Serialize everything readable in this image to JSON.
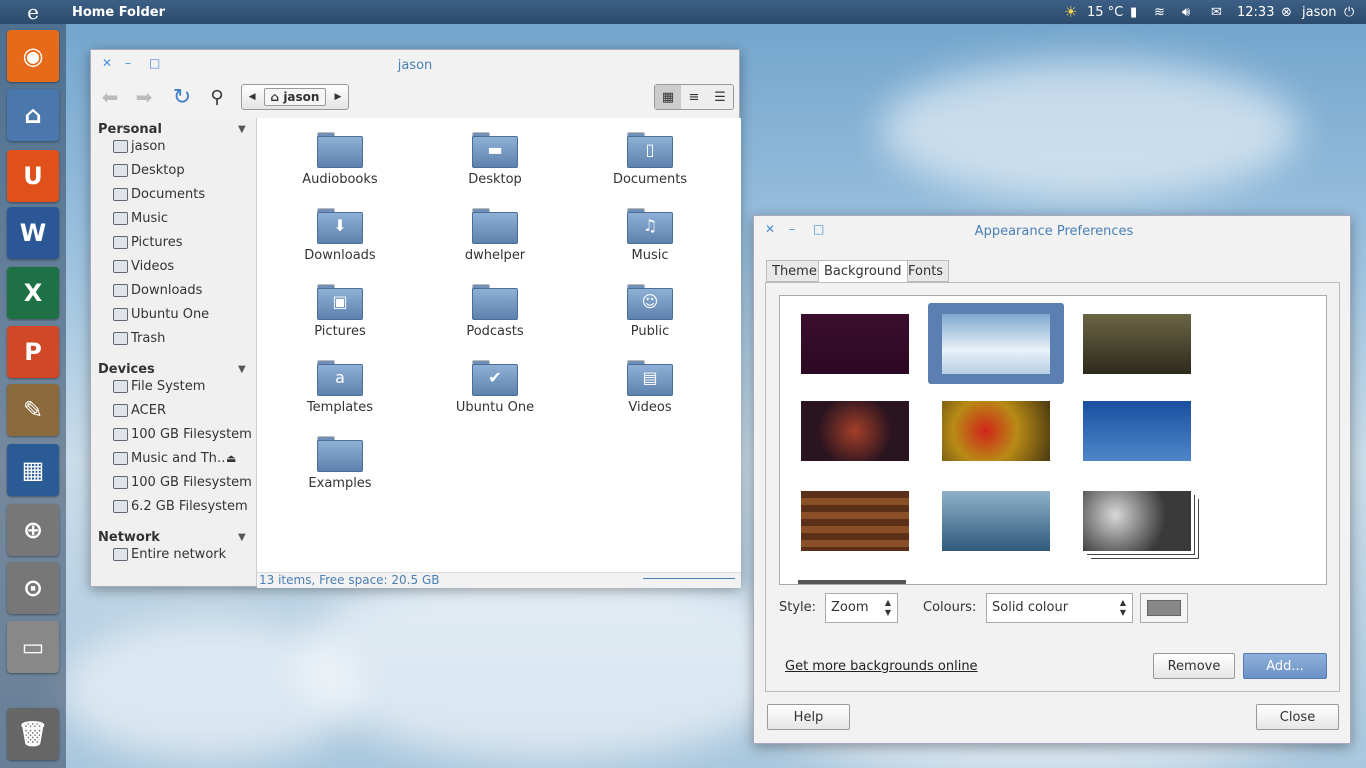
{
  "panel": {
    "logo": "e",
    "title": "Home Folder",
    "temp": "15 °C",
    "time": "12:33",
    "user": "jason"
  },
  "launcher": [
    {
      "name": "firefox-icon",
      "glyph": "◉",
      "color": "#e66a1a"
    },
    {
      "name": "home-folder-icon",
      "glyph": "⌂",
      "color": "#4a78ad"
    },
    {
      "name": "ubuntu-one-icon",
      "glyph": "U",
      "color": "#e0501b"
    },
    {
      "name": "word-icon",
      "glyph": "W",
      "color": "#2b5797"
    },
    {
      "name": "excel-icon",
      "glyph": "X",
      "color": "#1e7145"
    },
    {
      "name": "powerpoint-icon",
      "glyph": "P",
      "color": "#d24726"
    },
    {
      "name": "paint-icon",
      "glyph": "✎",
      "color": "#8b6b3c"
    },
    {
      "name": "workspace-icon",
      "glyph": "▦",
      "color": "#2a5b95"
    },
    {
      "name": "magnifier-icon",
      "glyph": "⊕",
      "color": "#777"
    },
    {
      "name": "search-file-icon",
      "glyph": "⊙",
      "color": "#777"
    },
    {
      "name": "drive-icon",
      "glyph": "▭",
      "color": "#888"
    },
    {
      "name": "trash-icon",
      "glyph": "🗑",
      "color": "#666"
    }
  ],
  "nautilus": {
    "title": "jason",
    "path": "jason",
    "sections": [
      {
        "title": "Personal",
        "items": [
          "jason",
          "Desktop",
          "Documents",
          "Music",
          "Pictures",
          "Videos",
          "Downloads",
          "Ubuntu One",
          "Trash"
        ]
      },
      {
        "title": "Devices",
        "items": [
          "File System",
          "ACER",
          "100 GB Filesystem",
          "Music and Th…",
          "100 GB Filesystem",
          "6.2 GB Filesystem"
        ]
      },
      {
        "title": "Network",
        "items": [
          "Entire network"
        ]
      }
    ],
    "files": [
      {
        "label": "Audiobooks",
        "emblem": ""
      },
      {
        "label": "Desktop",
        "emblem": "▬"
      },
      {
        "label": "Documents",
        "emblem": "▯"
      },
      {
        "label": "Downloads",
        "emblem": "⬇"
      },
      {
        "label": "dwhelper",
        "emblem": ""
      },
      {
        "label": "Music",
        "emblem": "♫"
      },
      {
        "label": "Pictures",
        "emblem": "▣"
      },
      {
        "label": "Podcasts",
        "emblem": ""
      },
      {
        "label": "Public",
        "emblem": "☺"
      },
      {
        "label": "Templates",
        "emblem": "a"
      },
      {
        "label": "Ubuntu One",
        "emblem": "✔"
      },
      {
        "label": "Videos",
        "emblem": "▤"
      },
      {
        "label": "Examples",
        "emblem": ""
      }
    ],
    "status": "13 items, Free space: 20.5 GB"
  },
  "appearance": {
    "title": "Appearance Preferences",
    "tabs": [
      "Theme",
      "Background",
      "Fonts"
    ],
    "style_label": "Style:",
    "style_value": "Zoom",
    "colours_label": "Colours:",
    "colours_value": "Solid colour",
    "more_link": "Get more backgrounds online",
    "remove": "Remove",
    "add": "Add...",
    "help": "Help",
    "close": "Close",
    "wallpapers": [
      {
        "name": "wallpaper-aubergine",
        "bg": "linear-gradient(#3a0f2e,#2c0822)"
      },
      {
        "name": "wallpaper-clouds",
        "bg": "linear-gradient(#7fa9d0,#e9f1f8 60%,#b8cfe4)"
      },
      {
        "name": "wallpaper-tree",
        "bg": "linear-gradient(#6b6645,#2e2a1c)"
      },
      {
        "name": "wallpaper-leaf",
        "bg": "radial-gradient(circle at 50% 50%,#a43f28,#2a1420 60%)"
      },
      {
        "name": "wallpaper-berries",
        "bg": "radial-gradient(circle at 40% 50%,#d0261a,#b88b16 45%,#4a3810)"
      },
      {
        "name": "wallpaper-branch-sky",
        "bg": "linear-gradient(#1a4fa0,#4f86c9)"
      },
      {
        "name": "wallpaper-wood",
        "bg": "repeating-linear-gradient(#5c3018 0 7px,#8a4f26 7px 14px)"
      },
      {
        "name": "wallpaper-frost",
        "bg": "linear-gradient(#8fb1c9,#2f5a7a)"
      },
      {
        "name": "wallpaper-bokeh",
        "bg": "radial-gradient(circle at 30% 40%,#d8d8d8,#3a3a3a 60%)"
      }
    ]
  }
}
